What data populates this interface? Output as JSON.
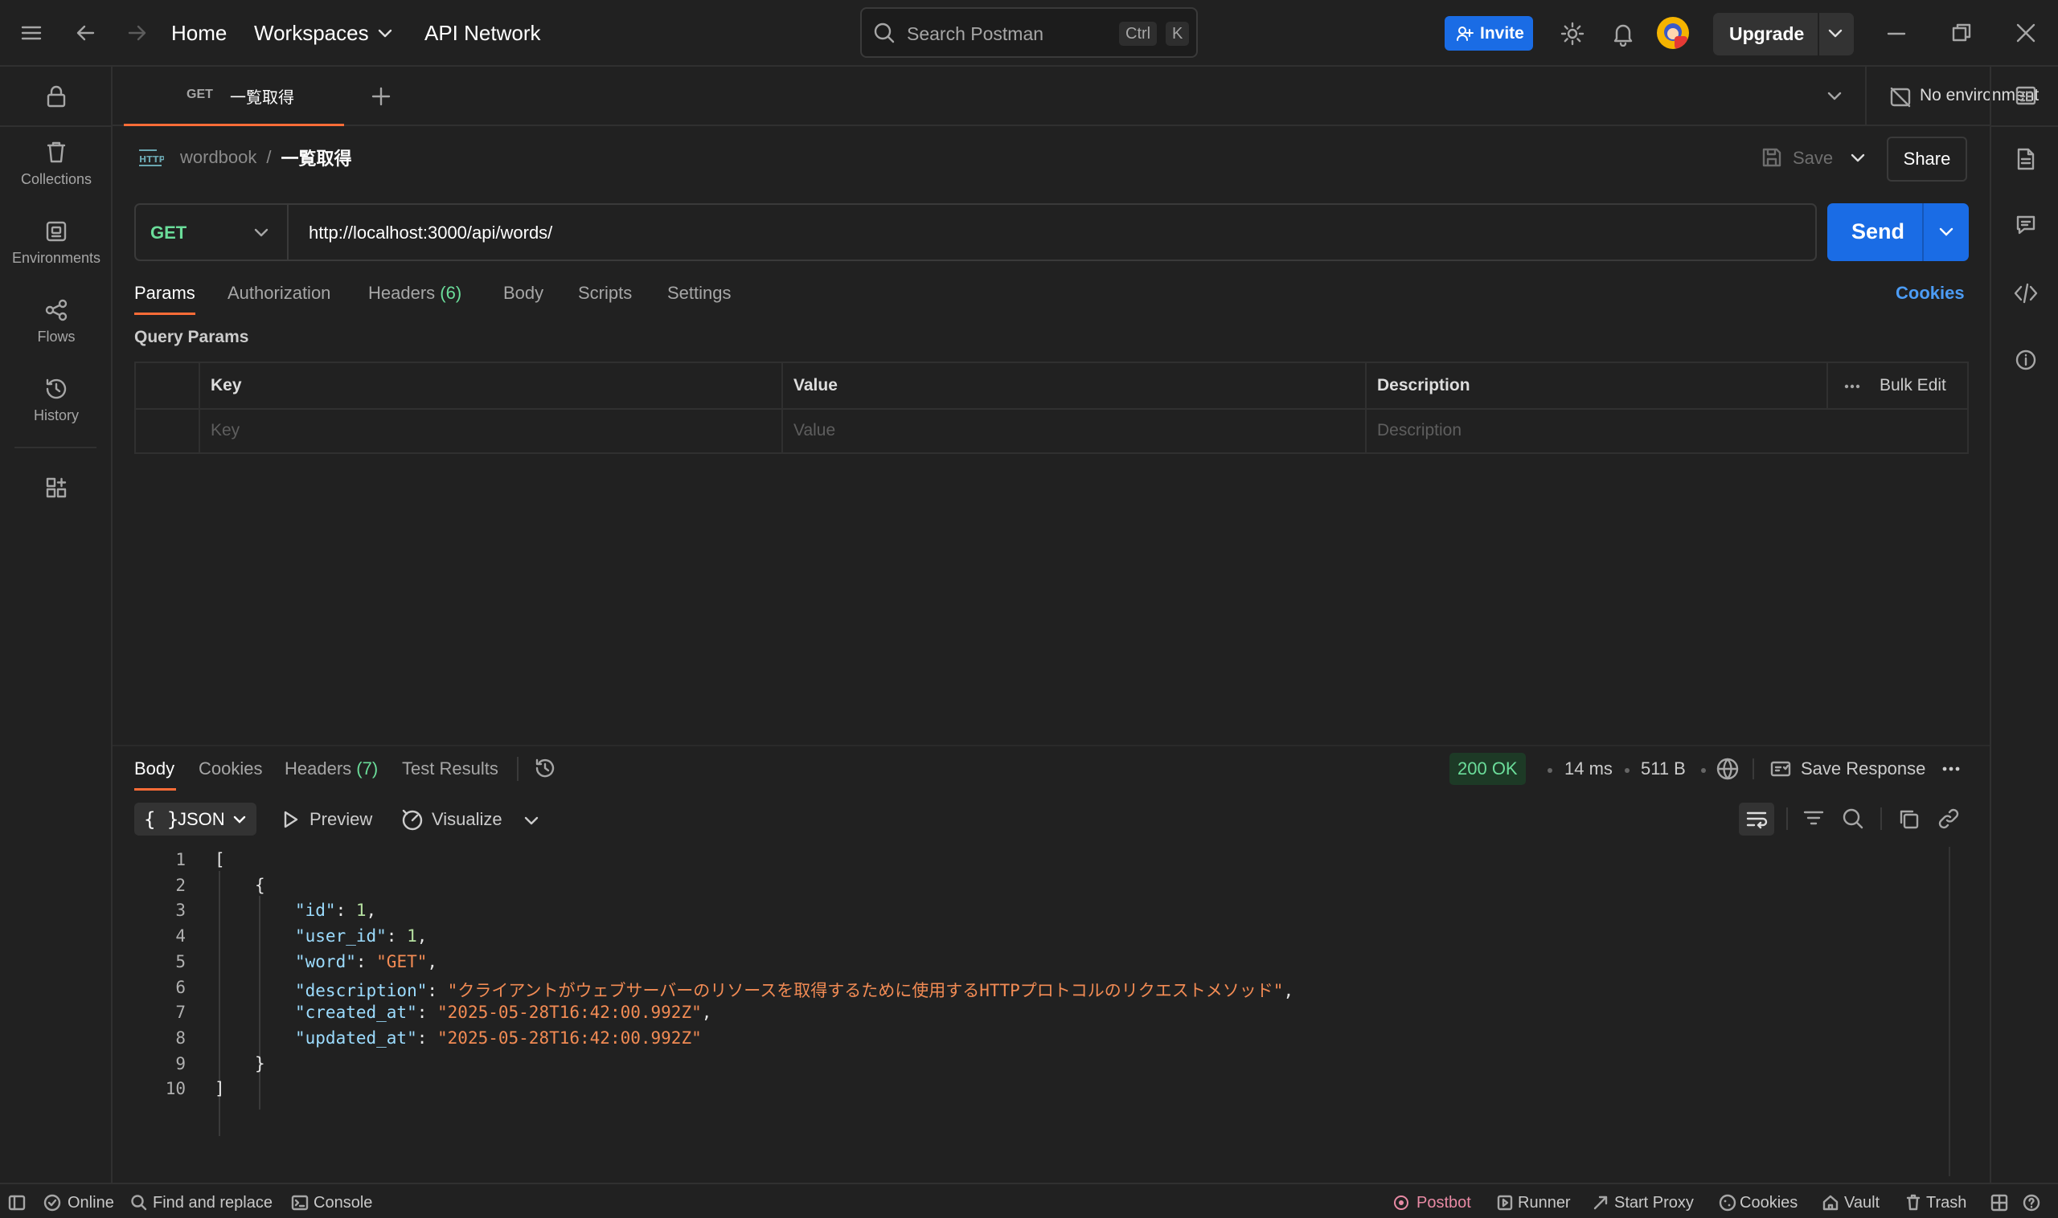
{
  "topbar": {
    "home": "Home",
    "workspaces": "Workspaces",
    "api_network": "API Network",
    "search_placeholder": "Search Postman",
    "kbd_ctrl": "Ctrl",
    "kbd_k": "K",
    "invite": "Invite",
    "upgrade": "Upgrade"
  },
  "sidebar": {
    "items": [
      {
        "label": "Collections",
        "icon": "trash-can-icon"
      },
      {
        "label": "Environments",
        "icon": "environment-icon"
      },
      {
        "label": "Flows",
        "icon": "flows-icon"
      },
      {
        "label": "History",
        "icon": "history-icon"
      }
    ]
  },
  "tab": {
    "method": "GET",
    "name": "一覧取得"
  },
  "environment": {
    "label": "No environment"
  },
  "breadcrumb": {
    "collection": "wordbook",
    "separator": "/",
    "request": "一覧取得"
  },
  "actions": {
    "save": "Save",
    "share": "Share"
  },
  "request": {
    "method": "GET",
    "url": "http://localhost:3000/api/words/",
    "send": "Send"
  },
  "request_tabs": {
    "params": "Params",
    "authorization": "Authorization",
    "headers": "Headers",
    "headers_count": "(6)",
    "body": "Body",
    "scripts": "Scripts",
    "settings": "Settings",
    "cookies": "Cookies"
  },
  "query_params": {
    "title": "Query Params",
    "columns": {
      "key": "Key",
      "value": "Value",
      "description": "Description"
    },
    "bulk_edit": "Bulk Edit",
    "placeholders": {
      "key": "Key",
      "value": "Value",
      "description": "Description"
    }
  },
  "response": {
    "tabs": {
      "body": "Body",
      "cookies": "Cookies",
      "headers": "Headers",
      "headers_count": "(7)",
      "test_results": "Test Results"
    },
    "status": "200 OK",
    "time": "14 ms",
    "size": "511 B",
    "save_response": "Save Response",
    "format": "JSON",
    "format_icon": "{ }",
    "preview": "Preview",
    "visualize": "Visualize",
    "lines": [
      {
        "n": "1",
        "text": "["
      },
      {
        "n": "2",
        "text": "{"
      },
      {
        "n": "3",
        "key": "\"id\"",
        "value": "1",
        "type": "num",
        "trail": ","
      },
      {
        "n": "4",
        "key": "\"user_id\"",
        "value": "1",
        "type": "num",
        "trail": ","
      },
      {
        "n": "5",
        "key": "\"word\"",
        "value": "\"GET\"",
        "type": "str",
        "trail": ","
      },
      {
        "n": "6",
        "key": "\"description\"",
        "value": "\"クライアントがウェブサーバーのリソースを取得するために使用するHTTPプロトコルのリクエストメソッド\"",
        "type": "str",
        "trail": ","
      },
      {
        "n": "7",
        "key": "\"created_at\"",
        "value": "\"2025-05-28T16:42:00.992Z\"",
        "type": "str",
        "trail": ","
      },
      {
        "n": "8",
        "key": "\"updated_at\"",
        "value": "\"2025-05-28T16:42:00.992Z\"",
        "type": "str",
        "trail": ""
      },
      {
        "n": "9",
        "text": "}"
      },
      {
        "n": "10",
        "text": "]"
      }
    ]
  },
  "statusbar": {
    "online": "Online",
    "find_replace": "Find and replace",
    "console": "Console",
    "postbot": "Postbot",
    "runner": "Runner",
    "start_proxy": "Start Proxy",
    "cookies": "Cookies",
    "vault": "Vault",
    "trash": "Trash"
  },
  "colors": {
    "accent": "#ff6c37",
    "primary": "#1a6ce5",
    "get_method": "#6bdd9a",
    "link": "#4c9cf5",
    "json_key": "#9cdcfe",
    "json_string": "#f28b54"
  }
}
